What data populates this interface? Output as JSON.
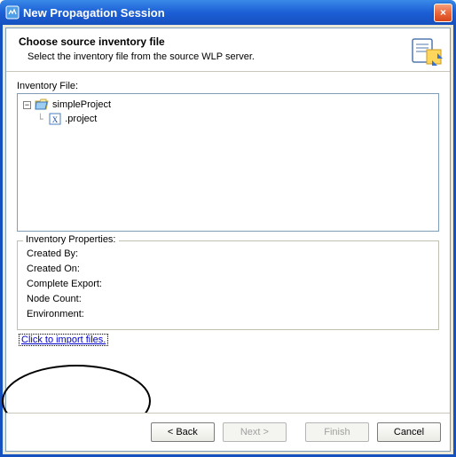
{
  "window": {
    "title": "New Propagation Session",
    "close_label": "×"
  },
  "header": {
    "title": "Choose source inventory file",
    "subtitle": "Select the inventory file from the source WLP server."
  },
  "tree": {
    "label": "Inventory File:",
    "root": {
      "label": "simpleProject",
      "expanded": true
    },
    "child": {
      "label": ".project"
    }
  },
  "properties": {
    "group_title": "Inventory Properties:",
    "rows": {
      "created_by": "Created By:",
      "created_on": "Created On:",
      "complete_export": "Complete Export:",
      "node_count": "Node Count:",
      "environment": "Environment:"
    }
  },
  "link": {
    "import_label": "Click to import files."
  },
  "buttons": {
    "back": "< Back",
    "next": "Next >",
    "finish": "Finish",
    "cancel": "Cancel"
  }
}
